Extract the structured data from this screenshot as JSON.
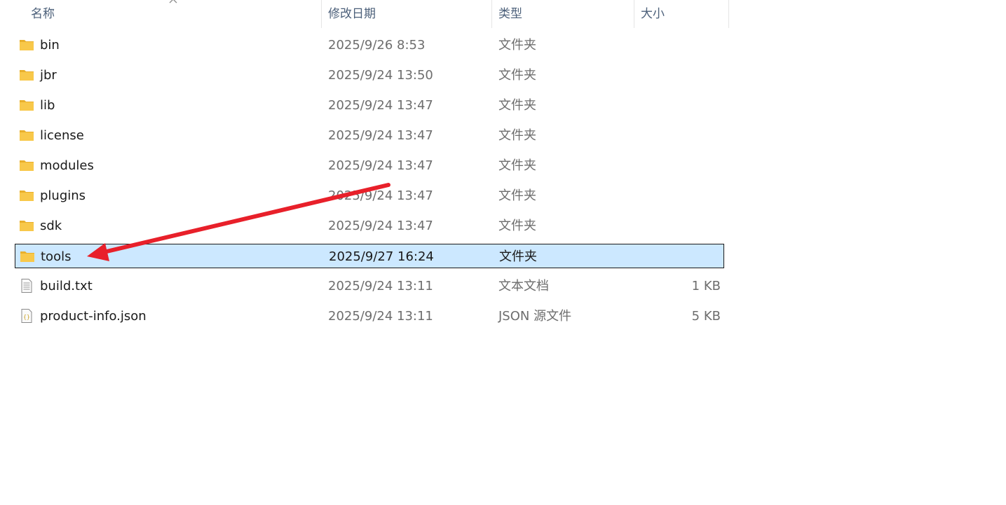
{
  "columns": {
    "name": "名称",
    "date": "修改日期",
    "type": "类型",
    "size": "大小"
  },
  "rows": [
    {
      "name": "bin",
      "date": "2025/9/26 8:53",
      "type": "文件夹",
      "size": "",
      "icon": "folder-icon"
    },
    {
      "name": "jbr",
      "date": "2025/9/24 13:50",
      "type": "文件夹",
      "size": "",
      "icon": "folder-icon"
    },
    {
      "name": "lib",
      "date": "2025/9/24 13:47",
      "type": "文件夹",
      "size": "",
      "icon": "folder-icon"
    },
    {
      "name": "license",
      "date": "2025/9/24 13:47",
      "type": "文件夹",
      "size": "",
      "icon": "folder-icon"
    },
    {
      "name": "modules",
      "date": "2025/9/24 13:47",
      "type": "文件夹",
      "size": "",
      "icon": "folder-icon"
    },
    {
      "name": "plugins",
      "date": "2025/9/24 13:47",
      "type": "文件夹",
      "size": "",
      "icon": "folder-icon"
    },
    {
      "name": "sdk",
      "date": "2025/9/24 13:47",
      "type": "文件夹",
      "size": "",
      "icon": "folder-icon"
    },
    {
      "name": "tools",
      "date": "2025/9/27 16:24",
      "type": "文件夹",
      "size": "",
      "icon": "folder-icon",
      "selected": true
    },
    {
      "name": "build.txt",
      "date": "2025/9/24 13:11",
      "type": "文本文档",
      "size": "1 KB",
      "icon": "text-file-icon"
    },
    {
      "name": "product-info.json",
      "date": "2025/9/24 13:11",
      "type": "JSON 源文件",
      "size": "5 KB",
      "icon": "json-file-icon"
    }
  ],
  "colors": {
    "selection": "#cce8ff",
    "folder": "#f8c84a",
    "annotation_arrow": "#e8202a",
    "header_text": "#4c607a"
  }
}
